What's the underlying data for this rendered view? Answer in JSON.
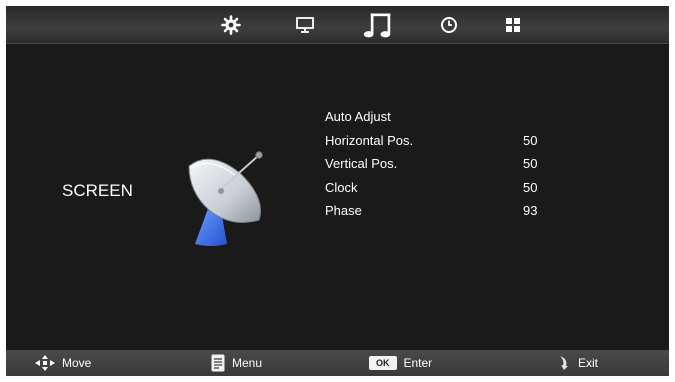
{
  "top_tabs": [
    {
      "icon": "settings-gear-icon"
    },
    {
      "icon": "monitor-icon"
    },
    {
      "icon": "music-note-icon",
      "selected": true
    },
    {
      "icon": "clock-icon"
    },
    {
      "icon": "grid-icon"
    }
  ],
  "section_title": "SCREEN",
  "section_icon": "satellite-dish-icon",
  "menu": [
    {
      "label": "Auto Adjust",
      "value": ""
    },
    {
      "label": "Horizontal Pos.",
      "value": "50"
    },
    {
      "label": "Vertical Pos.",
      "value": "50"
    },
    {
      "label": "Clock",
      "value": "50"
    },
    {
      "label": "Phase",
      "value": "93"
    }
  ],
  "footer": {
    "move": "Move",
    "menu": "Menu",
    "ok_key": "OK",
    "enter": "Enter",
    "exit": "Exit"
  }
}
